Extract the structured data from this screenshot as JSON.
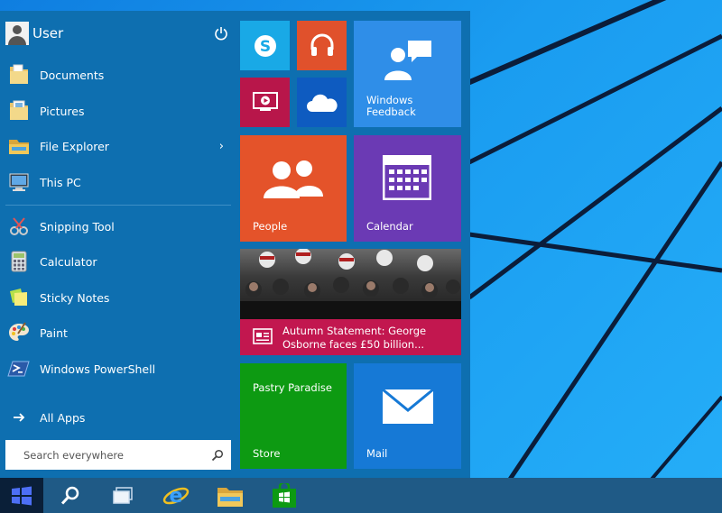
{
  "user": {
    "name": "User"
  },
  "menu": {
    "places": [
      {
        "label": "Documents",
        "icon": "folder-documents-icon"
      },
      {
        "label": "Pictures",
        "icon": "folder-pictures-icon"
      },
      {
        "label": "File Explorer",
        "icon": "file-explorer-icon",
        "has_submenu": true
      },
      {
        "label": "This PC",
        "icon": "computer-icon"
      }
    ],
    "apps": [
      {
        "label": "Snipping Tool",
        "icon": "snipping-tool-icon"
      },
      {
        "label": "Calculator",
        "icon": "calculator-icon"
      },
      {
        "label": "Sticky Notes",
        "icon": "sticky-notes-icon"
      },
      {
        "label": "Paint",
        "icon": "paint-palette-icon"
      },
      {
        "label": "Windows PowerShell",
        "icon": "powershell-icon"
      }
    ],
    "all_apps": "All Apps",
    "chevron": "›"
  },
  "search": {
    "placeholder": "Search everywhere"
  },
  "tiles": {
    "skype": {
      "icon": "skype-icon",
      "color": "#19a9e6"
    },
    "music": {
      "icon": "headphones-icon",
      "color": "#e0512c"
    },
    "video": {
      "icon": "video-icon",
      "color": "#b8164a"
    },
    "onedrive": {
      "icon": "onedrive-cloud-icon",
      "color": "#0e5bc0"
    },
    "feedback": {
      "label_line1": "Windows",
      "label_line2": "Feedback",
      "color": "#2f8ee8"
    },
    "people": {
      "label": "People",
      "color": "#e4532a"
    },
    "calendar": {
      "label": "Calendar",
      "color": "#6b3ab4"
    },
    "news": {
      "headline_line1": "Autumn Statement: George",
      "headline_line2": "Osborne faces £50 billion...",
      "color": "#c2174f"
    },
    "store": {
      "title": "Pastry Paradise",
      "label": "Store",
      "color": "#0d9a12"
    },
    "mail": {
      "label": "Mail",
      "color": "#1679d6"
    }
  },
  "taskbar": {
    "items": [
      "start-windows-icon",
      "search-icon",
      "task-view-icon",
      "internet-explorer-icon",
      "file-explorer-icon",
      "store-icon"
    ]
  }
}
